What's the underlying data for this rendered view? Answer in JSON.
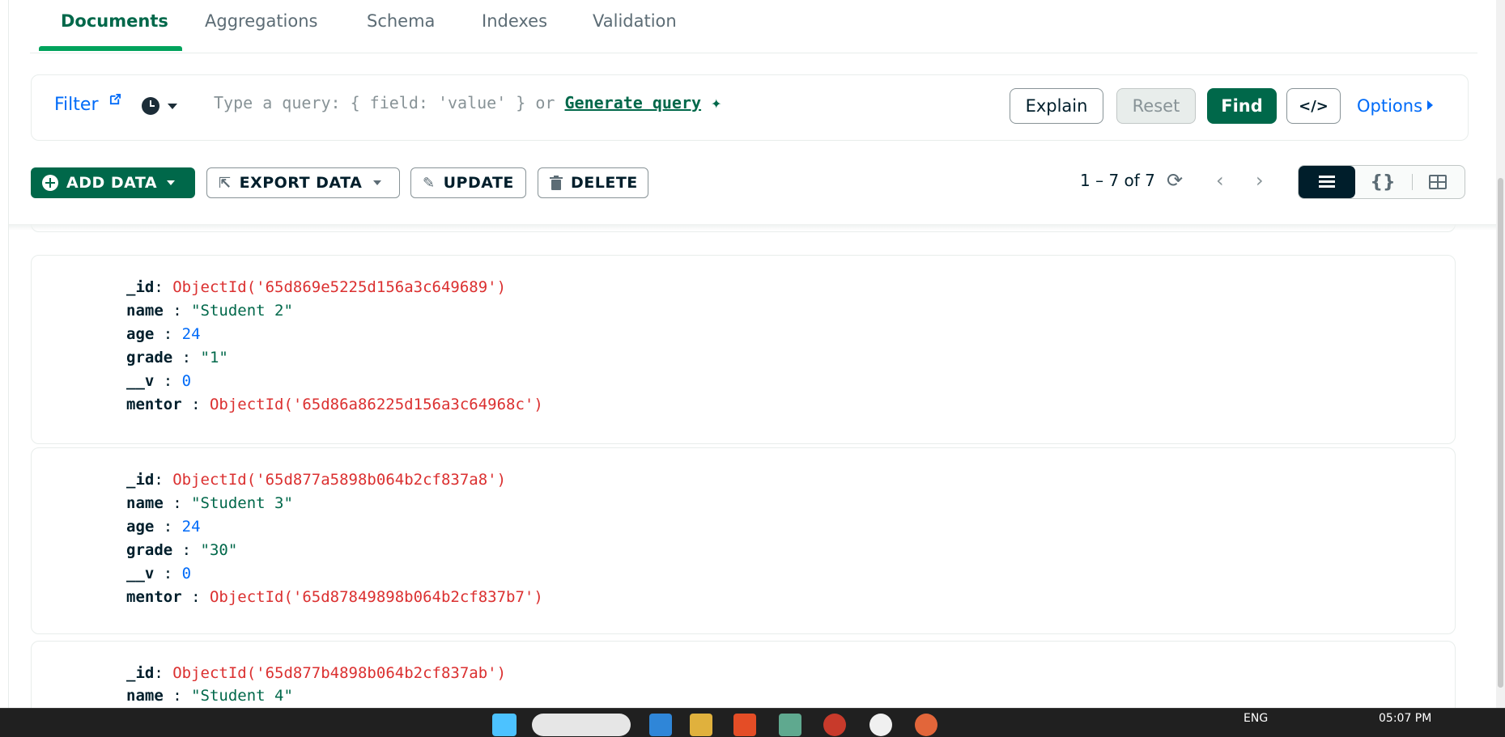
{
  "tabs": [
    {
      "label": "Documents"
    },
    {
      "label": "Aggregations"
    },
    {
      "label": "Schema"
    },
    {
      "label": "Indexes"
    },
    {
      "label": "Validation"
    }
  ],
  "query_bar": {
    "filter_label": "Filter",
    "placeholder_prefix": "Type a query: { field: 'value' } or ",
    "generate_query_label": "Generate query",
    "explain_label": "Explain",
    "reset_label": "Reset",
    "find_label": "Find",
    "code_label": "</>",
    "options_label": "Options"
  },
  "toolbar": {
    "add_data_label": "ADD DATA",
    "export_data_label": "EXPORT DATA",
    "update_label": "UPDATE",
    "delete_label": "DELETE",
    "pagination_text": "1 – 7 of 7",
    "json_view_label": "{}"
  },
  "documents": [
    {
      "fields": [
        {
          "key": "_id",
          "sep": ": ",
          "value": "ObjectId('65d869e5225d156a3c649689')",
          "type": "oid"
        },
        {
          "key": "name",
          "sep": " : ",
          "value": "\"Student 2\"",
          "type": "str"
        },
        {
          "key": "age",
          "sep": " : ",
          "value": "24",
          "type": "num"
        },
        {
          "key": "grade",
          "sep": " : ",
          "value": "\"1\"",
          "type": "str"
        },
        {
          "key": "__v",
          "sep": " : ",
          "value": "0",
          "type": "num"
        },
        {
          "key": "mentor",
          "sep": " : ",
          "value": "ObjectId('65d86a86225d156a3c64968c')",
          "type": "oid"
        }
      ]
    },
    {
      "fields": [
        {
          "key": "_id",
          "sep": ": ",
          "value": "ObjectId('65d877a5898b064b2cf837a8')",
          "type": "oid"
        },
        {
          "key": "name",
          "sep": " : ",
          "value": "\"Student 3\"",
          "type": "str"
        },
        {
          "key": "age",
          "sep": " : ",
          "value": "24",
          "type": "num"
        },
        {
          "key": "grade",
          "sep": " : ",
          "value": "\"30\"",
          "type": "str"
        },
        {
          "key": "__v",
          "sep": " : ",
          "value": "0",
          "type": "num"
        },
        {
          "key": "mentor",
          "sep": " : ",
          "value": "ObjectId('65d87849898b064b2cf837b7')",
          "type": "oid"
        }
      ]
    },
    {
      "fields": [
        {
          "key": "_id",
          "sep": ": ",
          "value": "ObjectId('65d877b4898b064b2cf837ab')",
          "type": "oid"
        },
        {
          "key": "name",
          "sep": " : ",
          "value": "\"Student 4\"",
          "type": "str"
        }
      ]
    }
  ],
  "taskbar": {
    "language": "ENG",
    "time": "05:07 PM"
  },
  "colors": {
    "brand_green": "#00684a",
    "link_blue": "#016bf8",
    "objectid_red": "#db3030",
    "dark": "#001e2b"
  }
}
